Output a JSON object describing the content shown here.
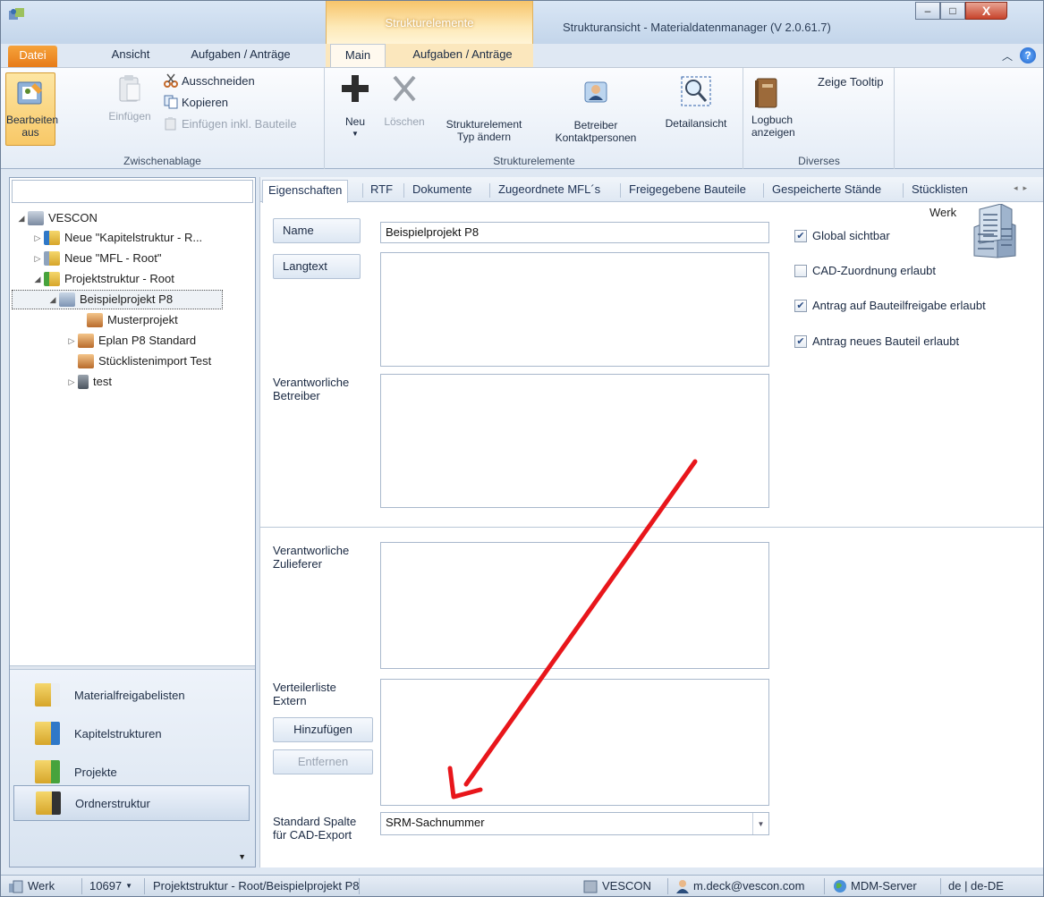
{
  "window": {
    "title": "Strukturansicht - Materialdatenmanager (V 2.0.61.7)",
    "context_tab_header": "Strukturelemente",
    "minimize": "–",
    "maximize": "□",
    "close": "X"
  },
  "ribbon_tabs": {
    "file": "Datei",
    "view": "Ansicht",
    "tasks": "Aufgaben / Anträge",
    "main": "Main",
    "ctx_tasks": "Aufgaben / Anträge",
    "help": "?"
  },
  "ribbon": {
    "edit_label_1": "Bearbeiten",
    "edit_label_2": "aus",
    "paste": "Einfügen",
    "cut": "Ausschneiden",
    "copy": "Kopieren",
    "paste_incl": "Einfügen inkl. Bauteile",
    "clipboard_group": "Zwischenablage",
    "new": "Neu",
    "delete": "Löschen",
    "change_type_1": "Strukturelement",
    "change_type_2": "Typ ändern",
    "operator_1": "Betreiber",
    "operator_2": "Kontaktpersonen",
    "detail_view": "Detailansicht",
    "elements_group": "Strukturelemente",
    "logbook_1": "Logbuch",
    "logbook_2": "anzeigen",
    "tooltip": "Zeige Tooltip",
    "misc_group": "Diverses"
  },
  "tree": {
    "root": "VESCON",
    "n1": "Neue \"Kapitelstruktur - R...",
    "n2": "Neue \"MFL - Root\"",
    "n3": "Projektstruktur - Root",
    "n4": "Beispielprojekt P8",
    "n5": "Musterprojekt",
    "n6": "Eplan P8 Standard",
    "n7": "Stücklistenimport Test",
    "n8": "test"
  },
  "nav": {
    "b1": "Materialfreigabelisten",
    "b2": "Kapitelstrukturen",
    "b3": "Projekte",
    "b4": "Ordnerstruktur"
  },
  "tabs": {
    "t1": "Eigenschaften",
    "t2": "RTF",
    "t3": "Dokumente",
    "t4": "Zugeordnete MFL´s",
    "t5": "Freigegebene Bauteile",
    "t6": "Gespeicherte Stände",
    "t7": "Stücklisten"
  },
  "form": {
    "name_label": "Name",
    "name_value": "Beispielprojekt P8",
    "longtext_label": "Langtext",
    "operators_label_1": "Verantworliche",
    "operators_label_2": "Betreiber",
    "suppliers_label_1": "Verantworliche",
    "suppliers_label_2": "Zulieferer",
    "dist_label_1": "Verteilerliste",
    "dist_label_2": "Extern",
    "add_button": "Hinzufügen",
    "remove_button": "Entfernen",
    "cad_label_1": "Standard Spalte",
    "cad_label_2": "für CAD-Export",
    "cad_value": "SRM-Sachnummer",
    "werk": "Werk"
  },
  "checkboxes": {
    "global_visible": "Global sichtbar",
    "cad_assignment": "CAD-Zuordnung erlaubt",
    "release_request": "Antrag auf Bauteilfreigabe erlaubt",
    "new_part_request": "Antrag neues Bauteil erlaubt"
  },
  "status": {
    "werk": "Werk",
    "number": "10697",
    "path": "Projektstruktur - Root/Beispielprojekt P8",
    "org": "VESCON",
    "user": "m.deck@vescon.com",
    "server": "MDM-Server",
    "locale": "de | de-DE"
  },
  "colors": {
    "annotation_arrow": "#e8161b",
    "file_tab": "#e77b19",
    "context_tab": "#f7c46a"
  }
}
